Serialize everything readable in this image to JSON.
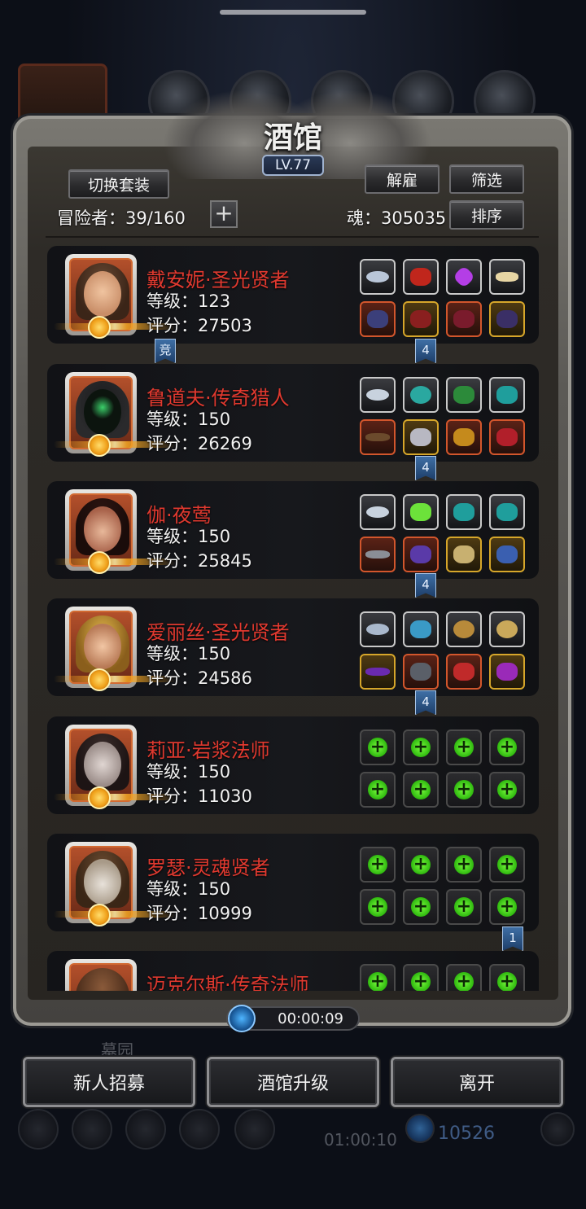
{
  "header": {
    "title": "酒馆",
    "level": "LV.77"
  },
  "toolbar": {
    "switch_outfit": "切换套装",
    "dismiss": "解雇",
    "filter": "筛选",
    "sort": "排序"
  },
  "stats": {
    "adventurers": "冒险者：39/160",
    "soul": "魂：305035"
  },
  "heroes": [
    {
      "name": "戴安妮·圣光贤者",
      "level": "等级：123",
      "score": "评分：27503"
    },
    {
      "name": "鲁道夫·传奇猎人",
      "level": "等级：150",
      "score": "评分：26269"
    },
    {
      "name": "伽·夜莺",
      "level": "等级：150",
      "score": "评分：25845"
    },
    {
      "name": "爱丽丝·圣光贤者",
      "level": "等级：150",
      "score": "评分：24586"
    },
    {
      "name": "莉亚·岩浆法师",
      "level": "等级：150",
      "score": "评分：11030"
    },
    {
      "name": "罗瑟·灵魂贤者",
      "level": "等级：150",
      "score": "评分：10999"
    },
    {
      "name": "迈克尔斯·传奇法师",
      "level": "",
      "score": ""
    }
  ],
  "tags": {
    "arena": "竞",
    "t1": "4",
    "t2": "4",
    "t3": "4",
    "t4": "4",
    "t5": "1"
  },
  "timer": "00:00:09",
  "background": {
    "grave": "墓园",
    "timer2": "01:00:10",
    "gems": "10526"
  },
  "footer": {
    "recruit": "新人招募",
    "upgrade": "酒馆升级",
    "leave": "离开"
  },
  "colors": {
    "hero_name": "#e0392f",
    "equip_plus": "#4ee01c",
    "tag_blue": "#2c568a"
  }
}
